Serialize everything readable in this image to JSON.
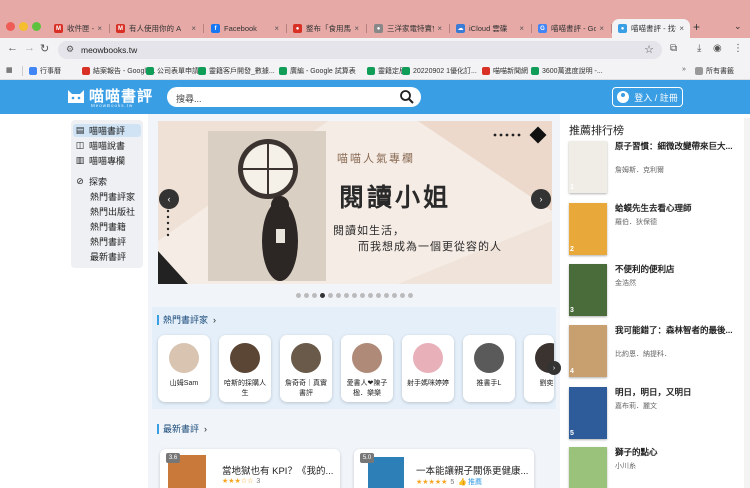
{
  "browser": {
    "tabs": [
      {
        "title": "收件匣 - kelvin",
        "icon_color": "#d93025",
        "icon": "M"
      },
      {
        "title": "有人使用你的 A",
        "icon_color": "#d93025",
        "icon": "M"
      },
      {
        "title": "Facebook",
        "icon_color": "#1877f2",
        "icon": "f"
      },
      {
        "title": "整布「食用馬鈴",
        "icon_color": "#d93025",
        "icon": "●"
      },
      {
        "title": "三洋家電特賣會",
        "icon_color": "#888888",
        "icon": "●"
      },
      {
        "title": "iCloud 雲碟",
        "icon_color": "#3a7bd5",
        "icon": "☁"
      },
      {
        "title": "喵喵書評 - Goo",
        "icon_color": "#4285f4",
        "icon": "G"
      },
      {
        "title": "喵喵書評 - 找行",
        "icon_color": "#3a9ee4",
        "icon": "●"
      }
    ],
    "new_tab": "+",
    "url": "meowbooks.tw",
    "bookmarks": [
      {
        "label": "行事曆",
        "color": "#4285f4"
      },
      {
        "label": "結案報告 - Google...",
        "color": "#d93025"
      },
      {
        "label": "公司表單申請",
        "color": "#0f9d58"
      },
      {
        "label": "靈籍客戶開發_數據...",
        "color": "#0f9d58"
      },
      {
        "label": "廣編 - Google 試算表",
        "color": "#0f9d58"
      },
      {
        "label": "靈籍定居",
        "color": "#0f9d58"
      },
      {
        "label": "20220902 1優化訂...",
        "color": "#0f9d58"
      },
      {
        "label": "喵喵新聞網",
        "color": "#d93025"
      },
      {
        "label": "3600萬進度說明 -...",
        "color": "#0f9d58"
      }
    ],
    "all_bookmarks": "所有書籤"
  },
  "header": {
    "logo": "喵喵書評",
    "logo_sub": "MeowBooks.tw",
    "search_placeholder": "搜尋...",
    "login": "登入 / 註冊"
  },
  "leftnav": {
    "items": [
      {
        "label": "喵喵書評",
        "icon": "book-icon"
      },
      {
        "label": "喵喵說書",
        "icon": "open-book-icon"
      },
      {
        "label": "喵喵專欄",
        "icon": "column-icon"
      }
    ],
    "explore": "探索",
    "sub": [
      "熱門書評家",
      "熱門出版社",
      "熱門書籍",
      "熱門書評",
      "最新書評"
    ]
  },
  "banner": {
    "tag": "喵喵人氣專欄",
    "title": "閱讀小姐",
    "line1": "閱讀如生活，",
    "line2": "而我想成為一個更從容的人",
    "active_slide": 3,
    "slide_count": 15
  },
  "reviewers": {
    "title": "熱門書評家",
    "items": [
      {
        "name": "山姆Sam"
      },
      {
        "name": "哈斯的採購人生"
      },
      {
        "name": "詹奇奇｜真實書評"
      },
      {
        "name": "愛書人❤陳子楹．樂樂"
      },
      {
        "name": "射手媽咪婷婷"
      },
      {
        "name": "推書手L"
      },
      {
        "name": "劉奕西"
      }
    ]
  },
  "latest": {
    "title": "最新書評",
    "items": [
      {
        "score": "3.6",
        "title": "當地獄也有 KPI？《我的...",
        "count": "3"
      },
      {
        "score": "5.0",
        "title": "一本能讓親子關係更健康...",
        "count": "5",
        "recommend": "推薦"
      }
    ]
  },
  "ranking": {
    "title": "推薦排行榜",
    "items": [
      {
        "rank": "1",
        "title": "原子習慣：細微改變帶來巨大...",
        "author": "詹姆斯．克利爾",
        "cover": "#f0ede6"
      },
      {
        "rank": "2",
        "title": "蛤蟆先生去看心理師",
        "author": "羅伯．狄保德",
        "cover": "#e8a93a"
      },
      {
        "rank": "3",
        "title": "不便利的便利店",
        "author": "金浩然",
        "cover": "#4a6b3a"
      },
      {
        "rank": "4",
        "title": "我可能錯了：森林智者的最後...",
        "author": "比約恩．納提科．",
        "cover": "#c8a070"
      },
      {
        "rank": "5",
        "title": "明日，明日，又明日",
        "author": "嘉布莉．麗文",
        "cover": "#2e5c9a"
      },
      {
        "rank": "6",
        "title": "獅子的點心",
        "author": "小川糸",
        "cover": "#9ac27a"
      }
    ]
  },
  "colors": {
    "brand": "#3a9ee4",
    "tabstrip": "#e6a9a6",
    "star": "#f5a623"
  }
}
